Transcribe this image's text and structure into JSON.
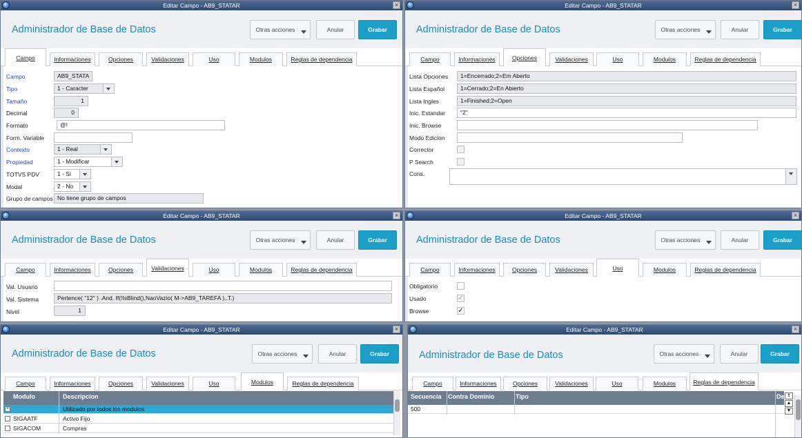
{
  "window_title": "Editar Campo - AB9_STATAR",
  "app_title": "Administrador de Base de Datos",
  "buttons": {
    "otras": "Otras acciones",
    "anular": "Anular",
    "grabar": "Grabar"
  },
  "close_glyph": "×",
  "tabs": [
    "Campo",
    "Informaciones",
    "Opciones",
    "Validaciones",
    "Uso",
    "Modulos",
    "Reglas de dependencia"
  ],
  "campo": {
    "labels": [
      "Campo",
      "Tipo",
      "Tamaño",
      "Decimal",
      "Formato",
      "Form. Variable",
      "Contexto",
      "Propiedad",
      "TOTVS PDV",
      "Modal",
      "Grupo de campos"
    ],
    "campo": "AB9_STATA",
    "tipo": "1 - Caracter",
    "tamano": "1",
    "decimal": "0",
    "formato": "@!",
    "form_variable": "",
    "contexto": "1 - Real",
    "propiedad": "1 - Modificar",
    "totvs_pdv": "1 - Si",
    "modal": "2 - No",
    "grupo": "No tiene grupo de campos"
  },
  "opciones": {
    "labels": [
      "Lista Opciones",
      "Lista Español",
      "Lista Ingles",
      "Inic. Estandar",
      "Inic. Browse",
      "Modo Edicion",
      "Corrector",
      "P Search",
      "Cons."
    ],
    "lista_opciones": "1=Encerrado;2=Em Aberto",
    "lista_espanol": "1=Cerrado;2=En Abierto",
    "lista_ingles": "1=Finished;2=Open",
    "inic_estandar": "\"2\"",
    "inic_browse": "",
    "modo_edicion": "",
    "cons": ""
  },
  "validaciones": {
    "labels": [
      "Val. Usuario",
      "Val. Sistema",
      "Nivel"
    ],
    "val_usuario": "",
    "val_sistema": "Pertence( \"12\" ) .And. If(!IsBlind(),NaoVazio( M->AB9_TAREFA ),.T.)",
    "nivel": "1"
  },
  "uso": {
    "labels": [
      "Obligatorio",
      "Usado",
      "Browse"
    ],
    "obligatorio": false,
    "usado": true,
    "browse": true,
    "check_glyph": "✓"
  },
  "modulos": {
    "columns": [
      "Modulo",
      "Descripcion"
    ],
    "rows": [
      {
        "modulo": "",
        "descripcion": "Utilizado por todos los modulos",
        "checked": true
      },
      {
        "modulo": "SIGAATF",
        "descripcion": "Activo Fijo",
        "checked": false
      },
      {
        "modulo": "SIGACOM",
        "descripcion": "Compras",
        "checked": false
      }
    ],
    "checked_glyph": "×"
  },
  "reglas": {
    "columns": [
      "Secuencia",
      "Contra Dominio",
      "Tipo",
      "De"
    ],
    "rows": [
      {
        "secuencia": "500",
        "contra_dominio": "",
        "tipo": ""
      }
    ],
    "scroll_glyphs": [
      "⯒",
      "▲",
      "▼"
    ]
  }
}
